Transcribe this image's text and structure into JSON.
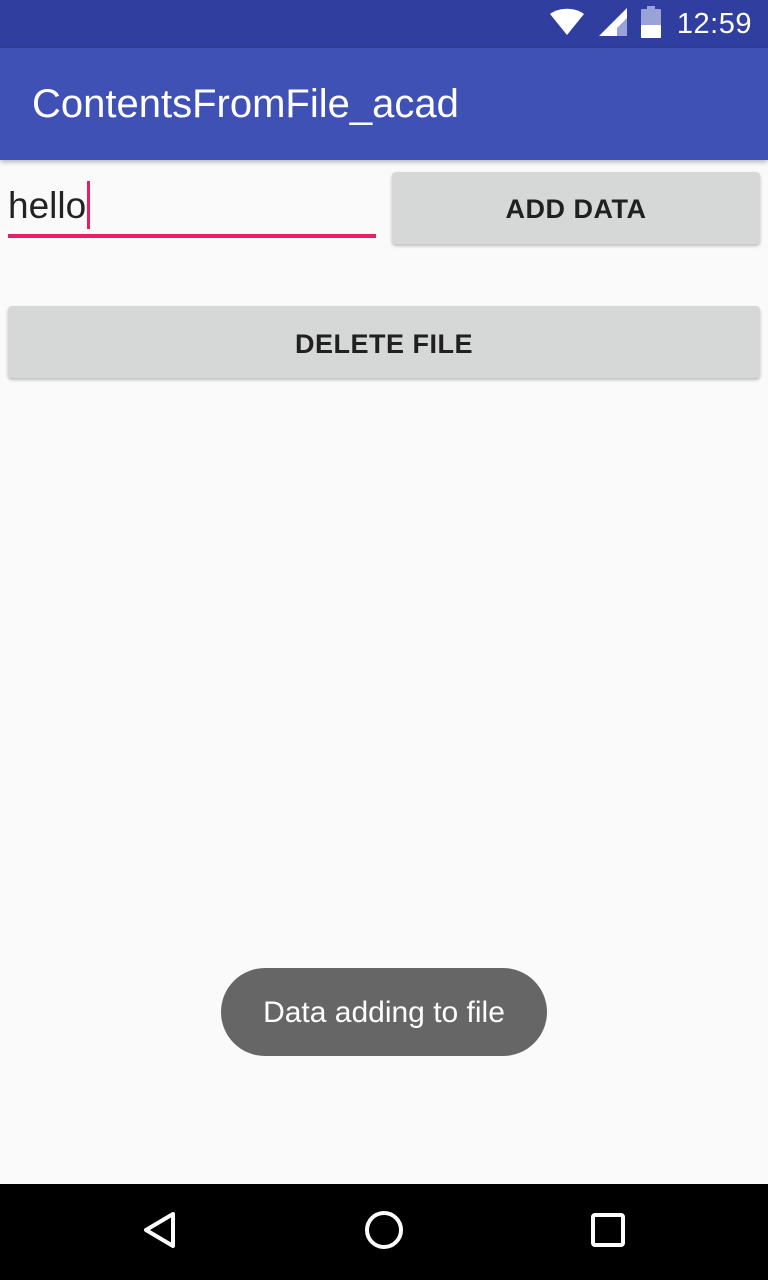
{
  "status_bar": {
    "time": "12:59",
    "icons": [
      "wifi-icon",
      "cell-signal-icon",
      "battery-icon"
    ],
    "background_color": "#303f9f"
  },
  "app_bar": {
    "title": "ContentsFromFile_acad",
    "background_color": "#3f51b5"
  },
  "form": {
    "input_value": "hello",
    "accent_color": "#e91e63",
    "add_button_label": "ADD DATA",
    "delete_button_label": "DELETE FILE"
  },
  "toast": {
    "message": "Data adding to file"
  },
  "nav_bar": {
    "buttons": [
      "back-icon",
      "home-icon",
      "recents-icon"
    ]
  }
}
